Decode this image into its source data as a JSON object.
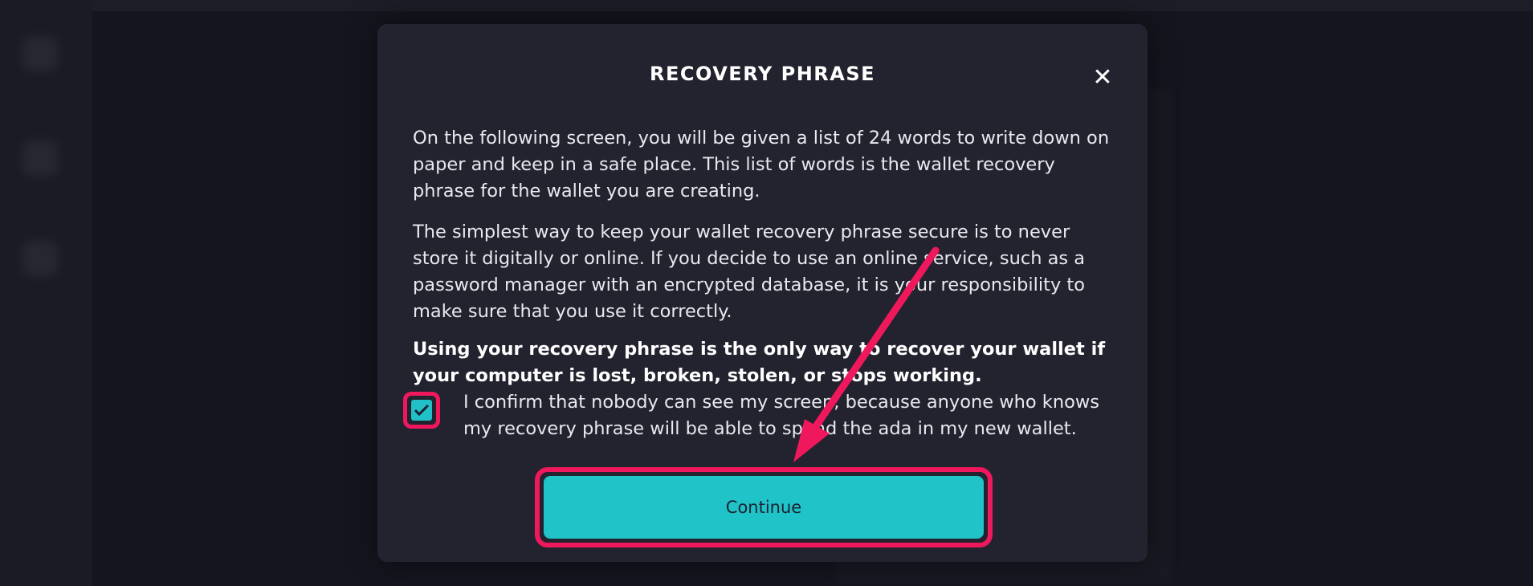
{
  "dialog": {
    "title": "RECOVERY PHRASE",
    "close_icon": "close-icon",
    "paragraph1": "On the following screen, you will be given a list of 24 words to write down on paper and keep in a safe place. This list of words is the wallet recovery phrase for the wallet you are creating.",
    "paragraph2": "The simplest way to keep your wallet recovery phrase secure is to never store it digitally or online. If you decide to use an online service, such as a password manager with an encrypted database, it is your responsibility to make sure that you use it correctly.",
    "paragraph3": "Using your recovery phrase is the only way to recover your wallet if your computer is lost, broken, stolen, or stops working.",
    "confirm_checkbox": {
      "checked": true,
      "label": "I confirm that nobody can see my screen, because anyone who knows my recovery phrase will be able to spend the ada in my new wallet."
    },
    "continue_label": "Continue"
  },
  "colors": {
    "dialog_background": "#22232f",
    "accent_teal": "#20c3c8",
    "highlight_pink": "#f0185d"
  }
}
